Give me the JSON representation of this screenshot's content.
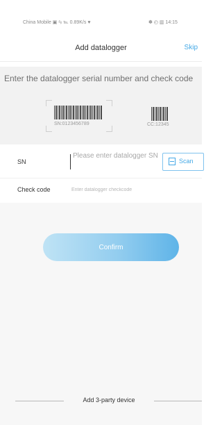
{
  "status_bar": {
    "left": "China Mobile ▣ ᵃᵢₗ ℡ 0.89K/s ♥",
    "right": "✽ ◴ ▥ 14:15"
  },
  "header": {
    "title": "Add datalogger",
    "skip_label": "Skip"
  },
  "instructions": {
    "text": "Enter the datalogger serial number and check code",
    "sn_example": "SN:0123456789",
    "cc_example": "CC:12345"
  },
  "form": {
    "sn_label": "SN",
    "sn_placeholder": "Please enter datalogger SN",
    "sn_value": "",
    "scan_label": "Scan",
    "check_code_label": "Check code",
    "check_code_placeholder": "Enter datalogger checkcode",
    "check_code_value": ""
  },
  "actions": {
    "confirm_label": "Confirm"
  },
  "footer": {
    "third_party_label": "Add 3-party device"
  },
  "colors": {
    "accent": "#43a8e6",
    "button_gradient_start": "#bfe3f5",
    "button_gradient_end": "#5fb4e8"
  }
}
